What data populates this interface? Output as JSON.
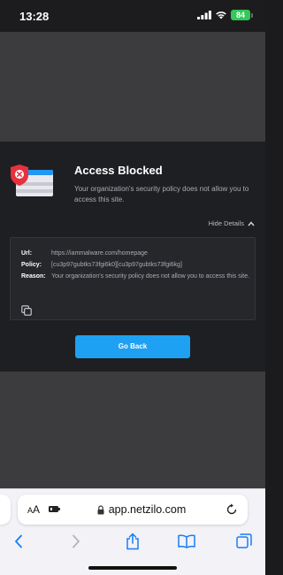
{
  "status_bar": {
    "time": "13:28",
    "battery": "84"
  },
  "blocked_page": {
    "title": "Access Blocked",
    "description": "Your organization's security policy does not allow you to access this site.",
    "details_toggle": "Hide Details",
    "details": [
      {
        "label": "Url:",
        "value": "https://iammalware.com/homepage"
      },
      {
        "label": "Policy:",
        "value": "[cu3p97gubtks73fgi6k0][cu3p97gubtks73fgi6kg]"
      },
      {
        "label": "Reason:",
        "value": "Your organization's security policy does not allow you to access this site."
      }
    ],
    "go_back_label": "Go Back"
  },
  "browser": {
    "aa_label_large": "A",
    "aa_label_small": "A",
    "url": "app.netzilo.com"
  },
  "colors": {
    "accent": "#1ea1f2",
    "shield": "#e8303f",
    "battery": "#34c759",
    "safari_blue": "#1a7cf5"
  },
  "icons": [
    "wifi-icon",
    "signal-icon",
    "shield-icon",
    "copy-icon",
    "lock-icon",
    "reload-icon",
    "extension-icon",
    "back-icon",
    "forward-icon",
    "share-icon",
    "bookmarks-icon",
    "tabs-icon",
    "chevron-up-icon"
  ]
}
